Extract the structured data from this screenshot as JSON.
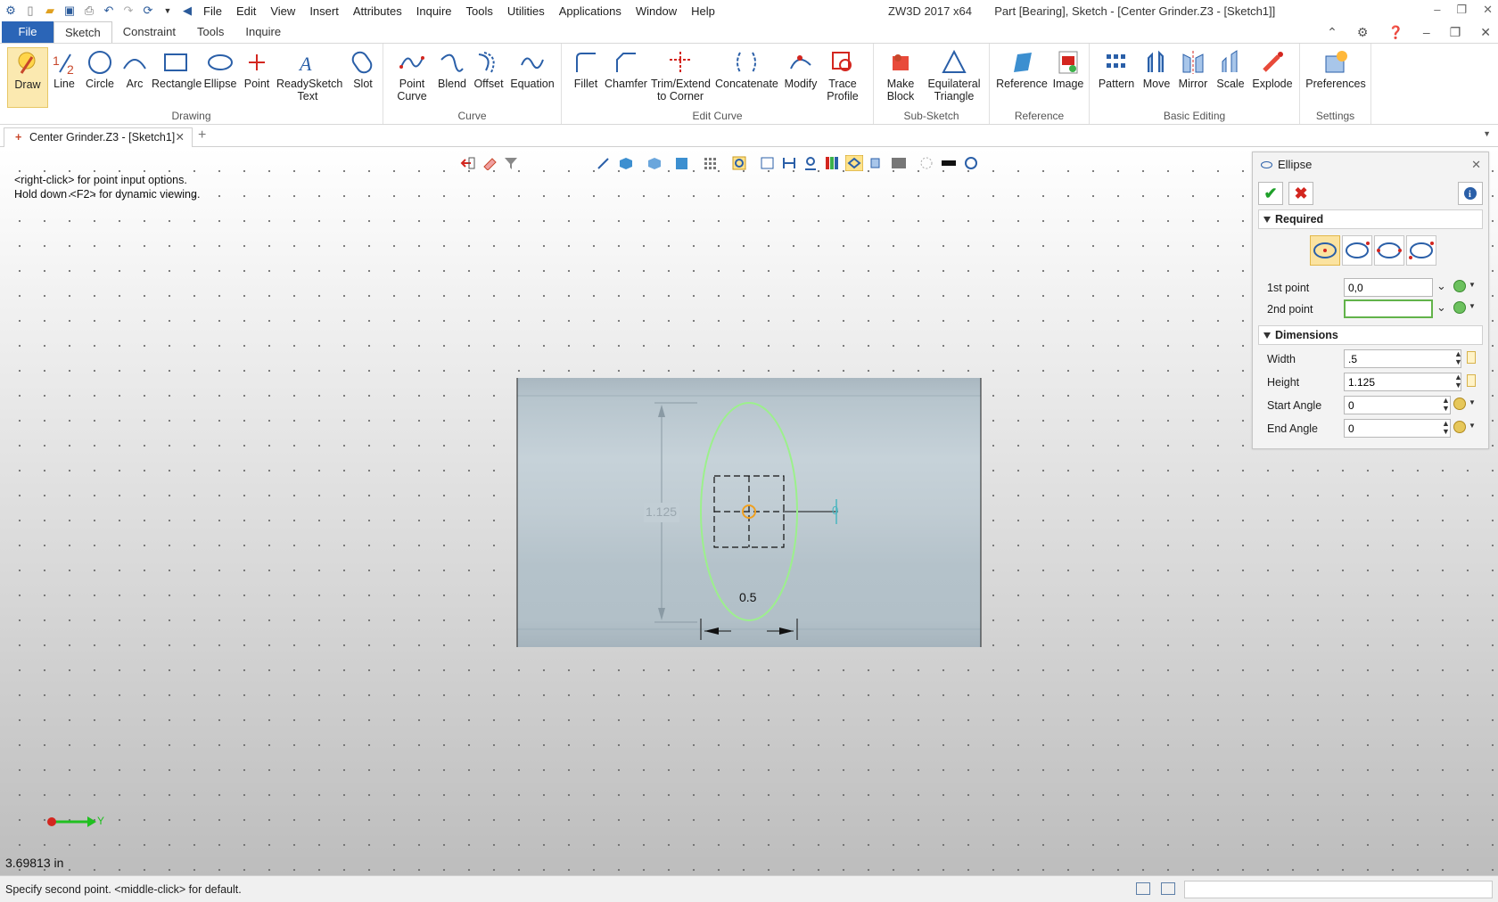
{
  "app": {
    "title": "ZW3D 2017  x64",
    "document_title": "Part [Bearing],  Sketch - [Center Grinder.Z3 - [Sketch1]]"
  },
  "menu": [
    "File",
    "Edit",
    "View",
    "Insert",
    "Attributes",
    "Inquire",
    "Tools",
    "Utilities",
    "Applications",
    "Window",
    "Help"
  ],
  "ribbon_tabs": [
    "File",
    "Sketch",
    "Constraint",
    "Tools",
    "Inquire"
  ],
  "ribbon": {
    "drawing": {
      "label": "Drawing",
      "buttons": [
        "Draw",
        "Line",
        "Circle",
        "Arc",
        "Rectangle",
        "Ellipse",
        "Point",
        "ReadySketch Text",
        "Slot"
      ]
    },
    "curve": {
      "label": "Curve",
      "buttons": [
        "Point Curve",
        "Blend",
        "Offset",
        "Equation"
      ]
    },
    "edit_curve": {
      "label": "Edit Curve",
      "buttons": [
        "Fillet",
        "Chamfer",
        "Trim/Extend to Corner",
        "Concatenate",
        "Modify",
        "Trace Profile"
      ]
    },
    "sub_sketch": {
      "label": "Sub-Sketch",
      "buttons": [
        "Make Block",
        "Equilateral Triangle"
      ]
    },
    "reference": {
      "label": "Reference",
      "buttons": [
        "Reference",
        "Image"
      ]
    },
    "basic_editing": {
      "label": "Basic Editing",
      "buttons": [
        "Pattern",
        "Move",
        "Mirror",
        "Scale",
        "Explode"
      ]
    },
    "settings": {
      "label": "Settings",
      "buttons": [
        "Preferences"
      ]
    }
  },
  "doc_tab": "Center Grinder.Z3 - [Sketch1]",
  "hints": {
    "line1": "<right-click> for point input options.",
    "line2": "Hold down <F2> for dynamic viewing."
  },
  "sketch": {
    "height_dim": "1.125",
    "width_dim": "0.5",
    "small_dim": "0"
  },
  "axis_label": "Y",
  "measure": "3.69813 in",
  "status": "Specify second point.  <middle-click> for default.",
  "panel": {
    "title": "Ellipse",
    "required_label": "Required",
    "first_point_label": "1st point",
    "first_point_value": "0,0",
    "second_point_label": "2nd point",
    "second_point_value": "",
    "dimensions_label": "Dimensions",
    "width_label": "Width",
    "width_value": ".5",
    "height_label": "Height",
    "height_value": "1.125",
    "start_angle_label": "Start Angle",
    "start_angle_value": "0",
    "end_angle_label": "End Angle",
    "end_angle_value": "0"
  },
  "colors": {
    "file_tab": "#2b65b7",
    "ellipse": "#9cf08c",
    "ok": "#1fa02a",
    "cancel": "#d3261f"
  }
}
